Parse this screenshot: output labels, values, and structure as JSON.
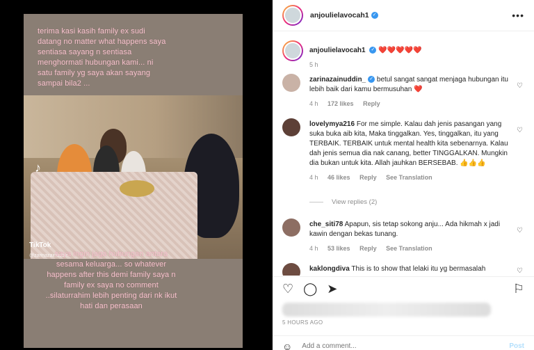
{
  "media": {
    "caption_top": "terima kasi kasih family ex sudi datang no matter what happens saya sentiasa sayang n sentiasa menghormati hubungan kami... ni satu family yg saya akan sayang sampai bila2 ...",
    "caption_bottom": "saya ingin jaga hubungan antara sesama keluarga... so whatever happens after this demi family saya n family ex saya no comment ..silaturrahim lebih penting dari nk ikut hati dan perasaan",
    "watermark": "TikTok",
    "watermark_handle": "@zarinazainuddin"
  },
  "header": {
    "username": "anjoulielavocah1",
    "more_icon": "more-horizontal-icon"
  },
  "post_caption": {
    "username": "anjoulielavocah1",
    "text": "❤️❤️❤️❤️❤️",
    "time": "5 h"
  },
  "comments": [
    {
      "username": "zarinazainuddin_",
      "text": " betul sangat sangat menjaga hubungan itu lebih baik dari kamu bermusuhan ❤️",
      "time": "4 h",
      "likes": "172 likes",
      "reply": "Reply"
    },
    {
      "username": "lovelymya216",
      "text": " For me simple. Kalau dah jenis pasangan yang suka buka aib kita, Maka tinggalkan. Yes, tinggalkan, itu yang TERBAIK. TERBAIK untuk mental health kita sebenarnya. Kalau dah jenis semua dia nak canang, better TINGGALKAN. Mungkin dia bukan untuk kita. Allah jauhkan BERSEBAB. 👍👍👍",
      "time": "4 h",
      "likes": "46 likes",
      "reply": "Reply",
      "translation": "See Translation",
      "view_replies": "View replies (2)"
    },
    {
      "username": "che_siti78",
      "text": " Apapun, sis tetap sokong anju... Ada hikmah x jadi kawin dengan bekas tunang.",
      "time": "4 h",
      "likes": "53 likes",
      "reply": "Reply",
      "translation": "See Translation"
    },
    {
      "username": "kaklongdiva",
      "text": " This is to show that lelaki itu yg bermasalah"
    }
  ],
  "footer": {
    "time_ago": "5 HOURS AGO",
    "comment_placeholder": "Add a comment...",
    "post_label": "Post"
  },
  "colors": {
    "caption_pink": "#f6c6cf",
    "link_blue": "#3897f0",
    "post_disabled": "#b2dffc"
  }
}
